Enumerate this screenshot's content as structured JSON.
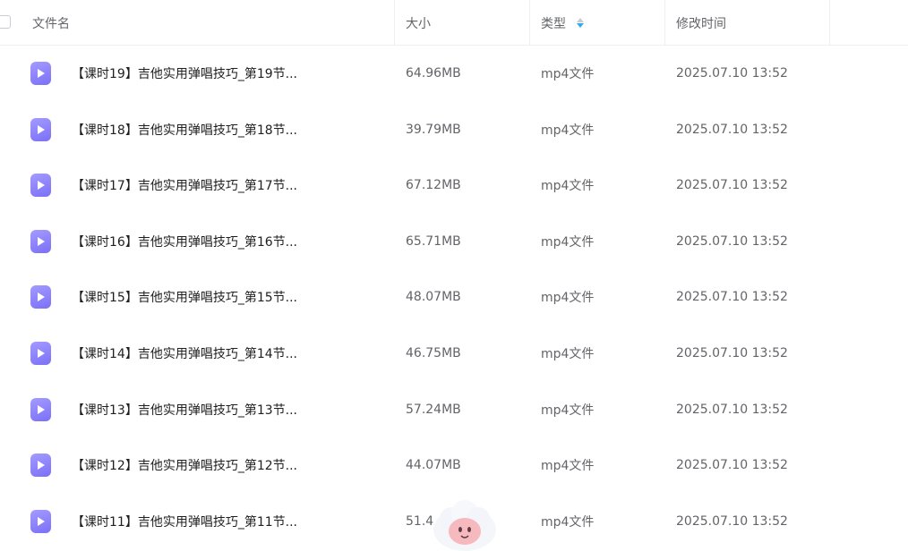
{
  "header": {
    "name_label": "文件名",
    "size_label": "大小",
    "type_label": "类型",
    "time_label": "修改时间"
  },
  "files": [
    {
      "name": "【课时19】吉他实用弹唱技巧_第19节...",
      "size": "64.96MB",
      "type": "mp4文件",
      "modified": "2025.07.10 13:52"
    },
    {
      "name": "【课时18】吉他实用弹唱技巧_第18节...",
      "size": "39.79MB",
      "type": "mp4文件",
      "modified": "2025.07.10 13:52"
    },
    {
      "name": "【课时17】吉他实用弹唱技巧_第17节...",
      "size": "67.12MB",
      "type": "mp4文件",
      "modified": "2025.07.10 13:52"
    },
    {
      "name": "【课时16】吉他实用弹唱技巧_第16节...",
      "size": "65.71MB",
      "type": "mp4文件",
      "modified": "2025.07.10 13:52"
    },
    {
      "name": "【课时15】吉他实用弹唱技巧_第15节...",
      "size": "48.07MB",
      "type": "mp4文件",
      "modified": "2025.07.10 13:52"
    },
    {
      "name": "【课时14】吉他实用弹唱技巧_第14节...",
      "size": "46.75MB",
      "type": "mp4文件",
      "modified": "2025.07.10 13:52"
    },
    {
      "name": "【课时13】吉他实用弹唱技巧_第13节...",
      "size": "57.24MB",
      "type": "mp4文件",
      "modified": "2025.07.10 13:52"
    },
    {
      "name": "【课时12】吉他实用弹唱技巧_第12节...",
      "size": "44.07MB",
      "type": "mp4文件",
      "modified": "2025.07.10 13:52"
    },
    {
      "name": "【课时11】吉他实用弹唱技巧_第11节...",
      "size": "51.4",
      "type": "mp4文件",
      "modified": "2025.07.10 13:52"
    }
  ],
  "icons": {
    "file": "video-file-icon",
    "sort": "sort-icon",
    "assistant": "assistant-mascot-icon"
  },
  "colors": {
    "accent": "#2fa8f5",
    "video_icon": "#8a7ff8",
    "header_text": "#636468",
    "row_text": "#1f1f1f"
  }
}
